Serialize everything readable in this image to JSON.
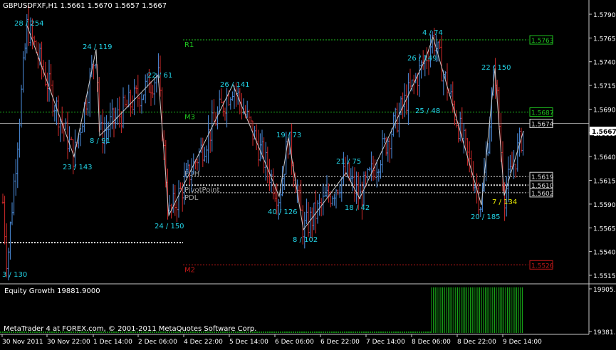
{
  "window": {
    "symbol_title": "GBPUSDFXF,H1  1.5661 1.5670 1.5657 1.5667",
    "indicator_title": "Equity Growth 19881.9000",
    "copyright": "MetaTrader 4 at FOREX.com, © 2001-2011 MetaQuotes Software Corp."
  },
  "colors": {
    "background": "#000000",
    "up_bar": "#4d8fdf",
    "down_bar": "#d12a2a",
    "zigzag": "#c8c8c8",
    "label_cyan": "#22d3e6",
    "label_yellow": "#e6e600",
    "level_green": "#1fc21f",
    "level_white": "#d8d8d8",
    "level_red": "#c01818",
    "equity": "#0e8a0e"
  },
  "chart_data": {
    "type": "candlestick",
    "ylim": [
      1.5506,
      1.5805
    ],
    "price_ticks": [
      "1.5790",
      "1.5765",
      "1.5740",
      "1.5715",
      "1.5690",
      "1.5665",
      "1.5640",
      "1.5615",
      "1.5590",
      "1.5565",
      "1.5540",
      "1.5515"
    ],
    "time_ticks": [
      "30 Nov 2011",
      "30 Nov 22:00",
      "1 Dec 14:00",
      "2 Dec 06:00",
      "4 Dec 22:00",
      "5 Dec 14:00",
      "6 Dec 06:00",
      "6 Dec 22:00",
      "7 Dec 14:00",
      "8 Dec 06:00",
      "8 Dec 22:00",
      "9 Dec 14:00"
    ],
    "current_price": "1.5667",
    "swing_labels": [
      {
        "text": "28 / 254",
        "price": 1.5778,
        "color": "cyan"
      },
      {
        "text": "3 / 130",
        "price": 1.5516,
        "color": "cyan"
      },
      {
        "text": "24 / 119",
        "price": 1.5752,
        "color": "cyan"
      },
      {
        "text": "23 / 143",
        "price": 1.5632,
        "color": "cyan"
      },
      {
        "text": "8 / 91",
        "price": 1.5656,
        "color": "cyan"
      },
      {
        "text": "22 / 61",
        "price": 1.5726,
        "color": "cyan"
      },
      {
        "text": "24 / 150",
        "price": 1.5574,
        "color": "cyan"
      },
      {
        "text": "26 / 141",
        "price": 1.5713,
        "color": "cyan"
      },
      {
        "text": "19 / 73",
        "price": 1.5665,
        "color": "cyan"
      },
      {
        "text": "40 / 126",
        "price": 1.5593,
        "color": "cyan"
      },
      {
        "text": "8 / 102",
        "price": 1.5557,
        "color": "cyan"
      },
      {
        "text": "21 / 75",
        "price": 1.563,
        "color": "cyan"
      },
      {
        "text": "18 / 42",
        "price": 1.5597,
        "color": "cyan"
      },
      {
        "text": "26 / 149",
        "price": 1.5745,
        "color": "cyan"
      },
      {
        "text": "4 / 74",
        "price": 1.5768,
        "color": "cyan"
      },
      {
        "text": "25 / 48",
        "price": 1.5688,
        "color": "cyan"
      },
      {
        "text": "22 / 150",
        "price": 1.5733,
        "color": "cyan"
      },
      {
        "text": "20 / 185",
        "price": 1.5589,
        "color": "cyan"
      },
      {
        "text": "7 / 134",
        "price": 1.5603,
        "color": "yellow"
      }
    ],
    "levels": [
      {
        "name": "R1",
        "price": 1.5763,
        "label": "1.5763",
        "color": "green"
      },
      {
        "name": "M3",
        "price": 1.5687,
        "label": "1.5687",
        "color": "green"
      },
      {
        "name": "",
        "price": 1.5675,
        "label": "1.5674",
        "color": "white"
      },
      {
        "name": "PDH",
        "price": 1.5619,
        "label": "1.5619",
        "color": "white"
      },
      {
        "name": "PivotPoint",
        "price": 1.561,
        "label": "1.5610",
        "color": "white"
      },
      {
        "name": "PDL",
        "price": 1.5602,
        "label": "1.5602",
        "color": "white"
      },
      {
        "name": "M2",
        "price": 1.5526,
        "label": "1.5526",
        "color": "red"
      }
    ],
    "equity": {
      "value": "19881.9000",
      "ticks": [
        "19905.7",
        "19381.5"
      ]
    }
  }
}
